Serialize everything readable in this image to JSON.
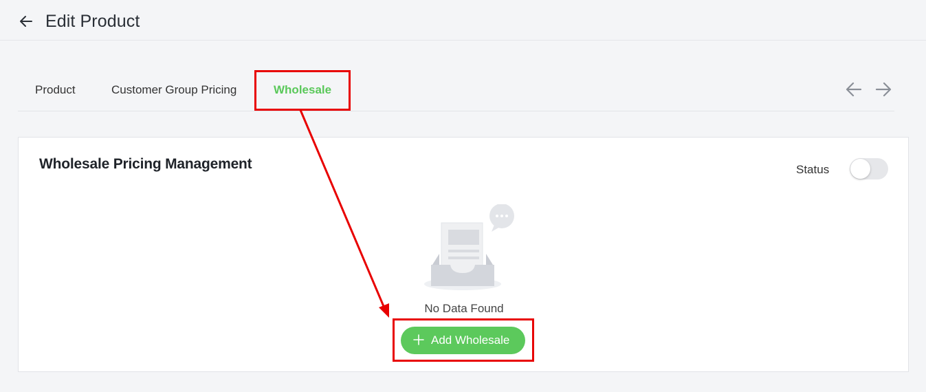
{
  "header": {
    "title": "Edit Product",
    "back_icon": "arrow-left-icon"
  },
  "tabs": [
    {
      "label": "Product",
      "active": false
    },
    {
      "label": "Customer Group Pricing",
      "active": false
    },
    {
      "label": "Wholesale",
      "active": true
    }
  ],
  "tab_nav": {
    "prev_icon": "arrow-left-icon",
    "next_icon": "arrow-right-icon"
  },
  "card": {
    "title": "Wholesale Pricing Management",
    "status_label": "Status",
    "status_on": false,
    "empty_text": "No Data Found",
    "add_button_label": "Add Wholesale",
    "add_button_icon": "plus-icon"
  },
  "colors": {
    "accent": "#5cc95c",
    "annotation": "#e80000",
    "background": "#f4f5f7"
  }
}
